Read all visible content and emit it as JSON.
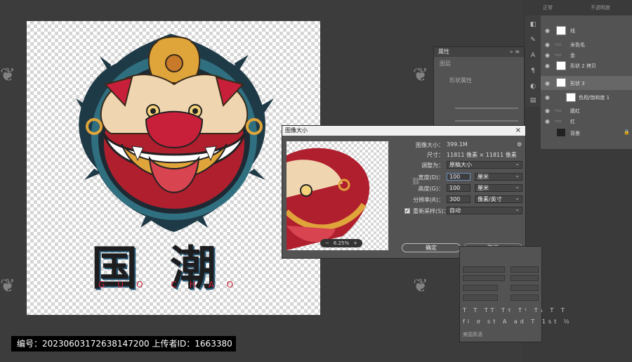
{
  "artwork": {
    "title_cn": "国潮",
    "title_pinyin": "GUO CHAO"
  },
  "footer": {
    "text": "编号：20230603172638147200  上传者ID：1663380"
  },
  "dialog": {
    "title": "图像大小",
    "close": "×",
    "image_size_label": "图像大小：",
    "image_size_value": "399.1M",
    "dimensions_label": "尺寸：",
    "dimensions_value": "11811 像素 × 11811 像素",
    "fit_label": "调整为：",
    "fit_value": "原稿大小",
    "width_label": "宽度(D)：",
    "width_value": "100",
    "width_unit": "厘米",
    "height_label": "高度(G)：",
    "height_value": "100",
    "height_unit": "厘米",
    "resolution_label": "分辨率(R)：",
    "resolution_value": "300",
    "resolution_unit": "像素/英寸",
    "resample_label": "重新采样(S)：",
    "resample_value": "自动",
    "resample_checked": "✓",
    "zoom_minus": "−",
    "zoom_value": "6.25%",
    "zoom_plus": "+",
    "ok": "确定",
    "cancel": "取消"
  },
  "properties": {
    "title": "属性",
    "subtitle": "图层",
    "shape_label": "形状属性"
  },
  "layers": {
    "blend": "正常",
    "opacity": "不透明度",
    "items": [
      {
        "name": "线"
      },
      {
        "name": "米色毛"
      },
      {
        "name": "金"
      },
      {
        "name": "形状 2 拷贝"
      },
      {
        "name": "形状 3"
      },
      {
        "name": "色相/饱和度 1"
      },
      {
        "name": "腮红"
      },
      {
        "name": "红"
      },
      {
        "name": "背景"
      }
    ]
  },
  "charpanel": {
    "lang": "美国英语"
  },
  "colors": {
    "dialog_bg": "#535353",
    "accent_red": "#c8203a",
    "title_ink": "#1d1d1f"
  }
}
